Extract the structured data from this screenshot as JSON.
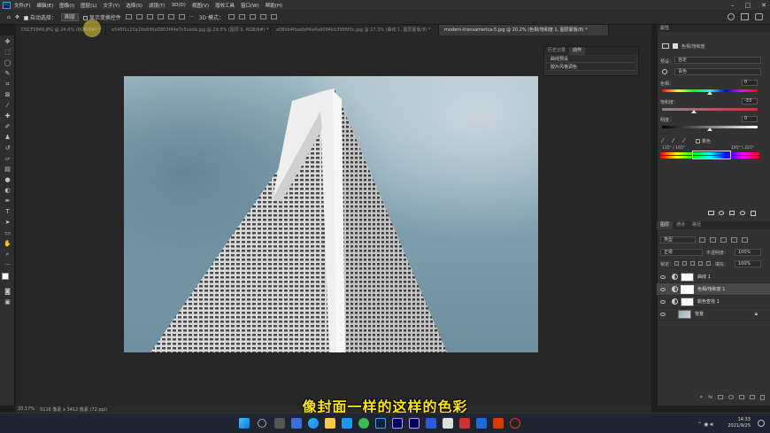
{
  "app": {
    "logo": "Ps",
    "menus": [
      "文件(F)",
      "编辑(E)",
      "图像(I)",
      "图层(L)",
      "文字(Y)",
      "选择(S)",
      "滤镜(T)",
      "3D(D)",
      "视图(V)",
      "增效工具",
      "窗口(W)",
      "帮助(H)"
    ]
  },
  "options": {
    "auto_select": "自动选择：",
    "target": "图层",
    "show_transform": "显示变换控件",
    "mode_3d": "3D 模式：",
    "more": "···"
  },
  "tabs": [
    {
      "label": "DSCF5849.JPG @ 24.6% (RGB/8#) *"
    },
    {
      "label": "e545f1c25a18e845e5803f44e7c5ceda.jpg @ 29.5% (图层 0, RGB/8#) *"
    },
    {
      "label": "a08db4fbaebff4a4a9094b10986f0c.jpg @ 27.3% (曲线 1, 图层蒙版/8) *"
    },
    {
      "label": "modern-transamerica-5.jpg @ 20.2% (色相/饱和度 1, 图层蒙版/8) *",
      "active": true
    }
  ],
  "mini_panel": {
    "tabs": [
      "历史记录",
      "动作"
    ],
    "items": [
      "曲线预设",
      "胶片风格调色"
    ]
  },
  "properties": {
    "tab": "属性",
    "title": "色相/饱和度",
    "preset_label": "预设：",
    "preset_value": "自定",
    "channel": "青色",
    "hue_label": "色相：",
    "hue_value": "0",
    "saturation_label": "饱和度：",
    "saturation_value": "-33",
    "lightness_label": "明度：",
    "lightness_value": "0",
    "colorize": "着色",
    "range_left": "135° / 165°",
    "range_right": "195° \\ 225°"
  },
  "layers": {
    "tabs": [
      "图层",
      "通道",
      "路径"
    ],
    "kind": "类型",
    "blend": "正常",
    "opacity_label": "不透明度：",
    "opacity": "100%",
    "lock_label": "锁定：",
    "fill_label": "填充：",
    "fill": "100%",
    "items": [
      {
        "name": "曲线 1",
        "selected": false
      },
      {
        "name": "色相/饱和度 1",
        "selected": true
      },
      {
        "name": "颜色查找 1",
        "selected": false
      },
      {
        "name": "背景",
        "selected": false
      }
    ]
  },
  "status": {
    "zoom": "20.17%",
    "dims": "5116 像素 x 3412 像素 (72 ppi)"
  },
  "subtitle": "像封面一样的这样的色彩",
  "clock": {
    "time": "14:33",
    "date": "2021/9/25"
  },
  "colors": {
    "accent": "#31a8ff",
    "subtitle": "#ffe600",
    "sky": "#7a9fae"
  }
}
